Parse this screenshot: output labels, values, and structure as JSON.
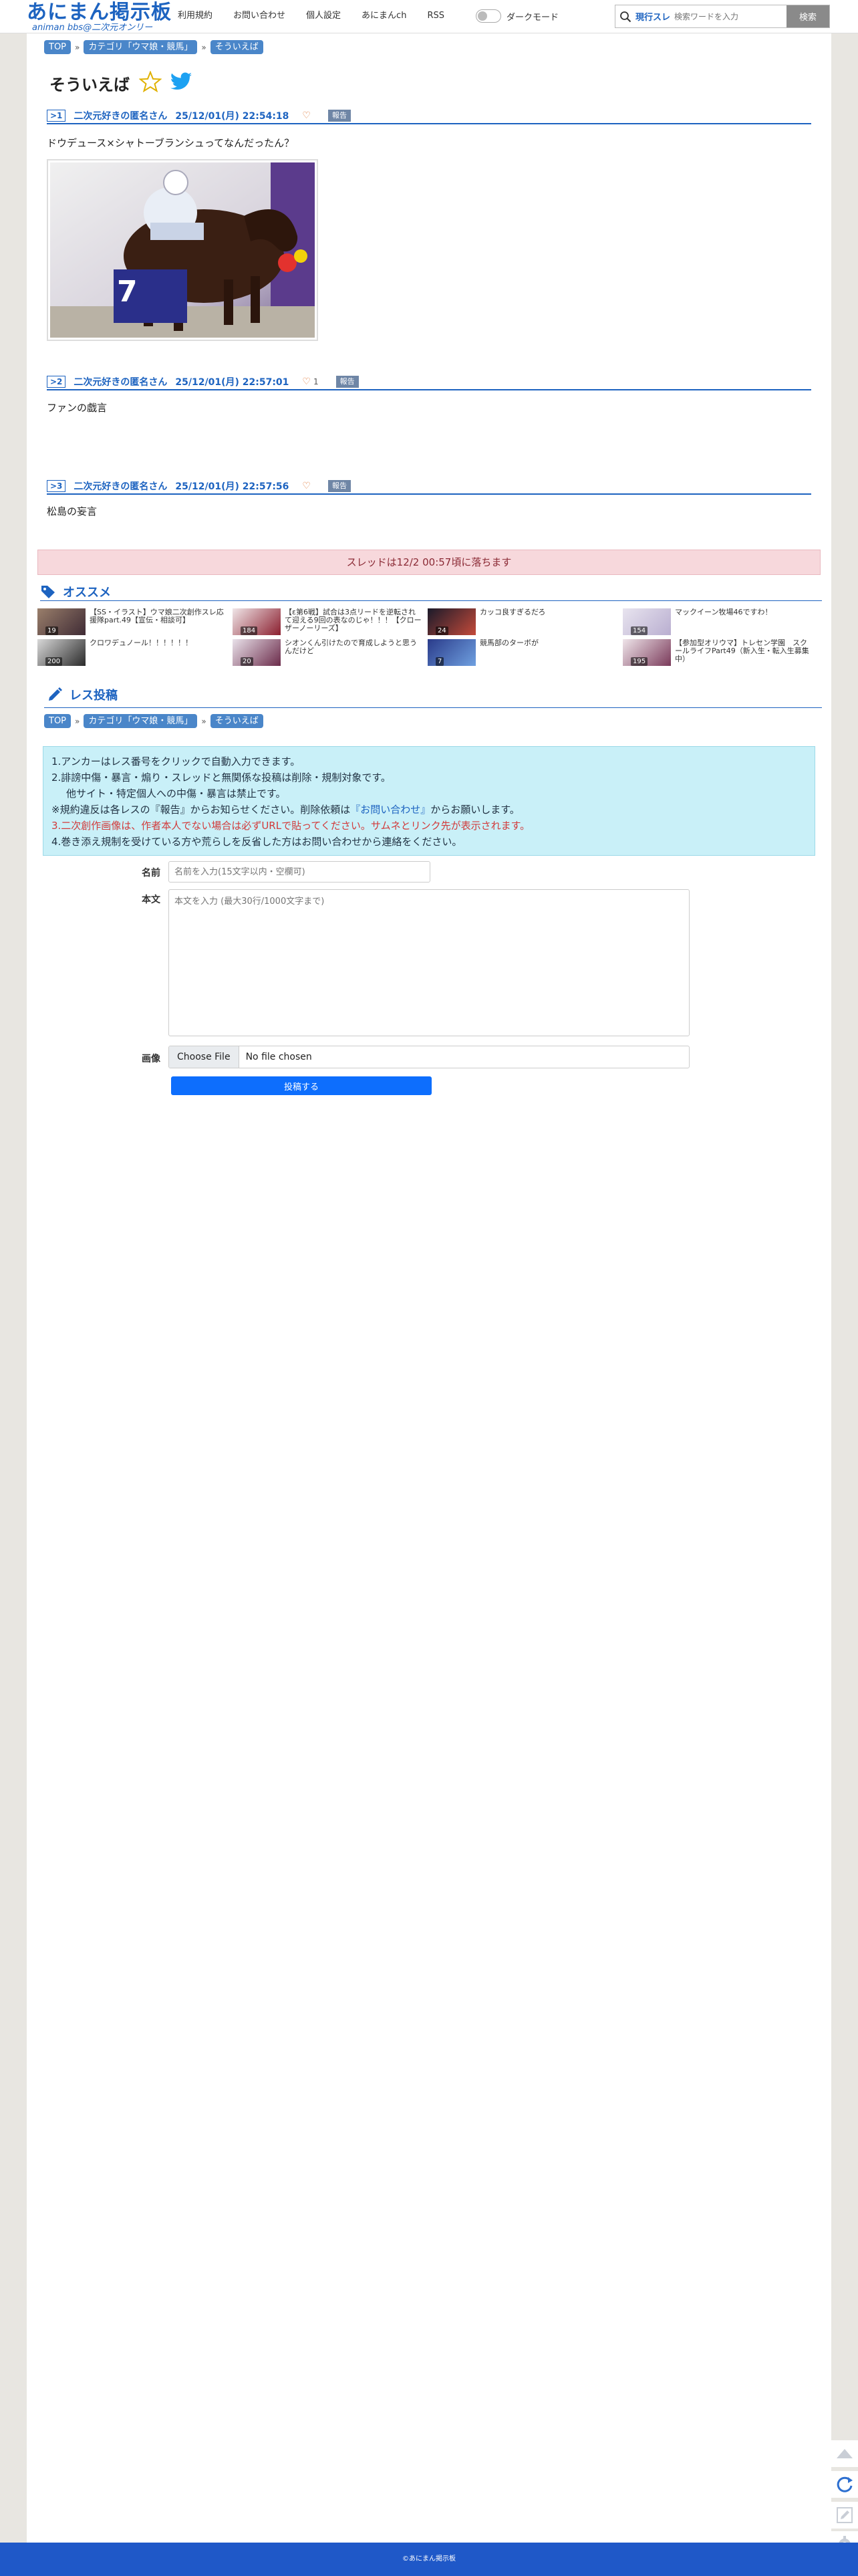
{
  "header": {
    "logo_main": "あにまん掲示板",
    "logo_sub": "animan bbs@二次元オンリー",
    "nav": [
      "利用規約",
      "お問い合わせ",
      "個人設定",
      "あにまんch",
      "RSS"
    ],
    "dark_mode_label": "ダークモード",
    "search_scope": "現行スレ",
    "search_placeholder": "検索ワードを入力",
    "search_button": "検索"
  },
  "breadcrumb": [
    "TOP",
    "カテゴリ「ウマ娘・競馬」",
    "そういえば"
  ],
  "thread": {
    "title": "そういえば",
    "posts": [
      {
        "num": ">1",
        "author": "二次元好きの匿名さん",
        "date": "25/12/01(月) 22:54:18",
        "likes": "",
        "report": "報告",
        "body": "ドウデュース×シャトーブランシュってなんだったん？",
        "has_image": true
      },
      {
        "num": ">2",
        "author": "二次元好きの匿名さん",
        "date": "25/12/01(月) 22:57:01",
        "likes": "1",
        "report": "報告",
        "body": "ファンの戯言",
        "has_image": false
      },
      {
        "num": ">3",
        "author": "二次元好きの匿名さん",
        "date": "25/12/01(月) 22:57:56",
        "likes": "",
        "report": "報告",
        "body": "松島の妄言",
        "has_image": false
      }
    ],
    "image_jersey_number": "7"
  },
  "fall_notice": "スレッドは12/2 00:57頃に落ちます",
  "recommend": {
    "heading": "オススメ",
    "items": [
      {
        "title": "【SS・イラスト】ウマ娘二次創作スレ応援隊part.49【宣伝・相談可】",
        "count": "19"
      },
      {
        "title": "【ε第6戦】試合は3点リードを逆転されて迎える9回の表なのじゃ！！！【クローザーノーリーズ】",
        "count": "184"
      },
      {
        "title": "カッコ良すぎるだろ",
        "count": "24"
      },
      {
        "title": "マックイーン牧場46ですわ！",
        "count": "154"
      },
      {
        "title": "クロワデュノール！！！！！！",
        "count": "200"
      },
      {
        "title": "シオンくん引けたので育成しようと思うんだけど",
        "count": "20"
      },
      {
        "title": "競馬部のターボが",
        "count": "7"
      },
      {
        "title": "【参加型オリウマ】トレセン学園　スクールライフPart49（新入生・転入生募集中）",
        "count": "195"
      }
    ]
  },
  "reply_form": {
    "heading": "レス投稿",
    "rules": [
      "1.アンカーはレス番号をクリックで自動入力できます。",
      "2.誹謗中傷・暴言・煽り・スレッドと無関係な投稿は削除・規制対象です。",
      "他サイト・特定個人への中傷・暴言は禁止です。",
      "※規約違反は各レスの『報告』からお知らせください。削除依頼は",
      "『お問い合わせ』",
      "からお願いします。",
      "3.二次創作画像は、作者本人でない場合は必ずURLで貼ってください。サムネとリンク先が表示されます。",
      "4.巻き添え規制を受けている方や荒らしを反省した方はお問い合わせから連絡をください。"
    ],
    "name_label": "名前",
    "name_placeholder": "名前を入力(15文字以内・空欄可)",
    "body_label": "本文",
    "body_placeholder": "本文を入力 (最大30行/1000文字まで)",
    "image_label": "画像",
    "file_button": "Choose File",
    "file_status": "No file chosen",
    "submit": "投稿する"
  },
  "footer": "©あにまん掲示板",
  "colors": {
    "accent": "#1d63c0",
    "footer": "#1f58c8",
    "notice_bg": "#f7d8dc",
    "rules_bg": "#c9f0f8"
  }
}
